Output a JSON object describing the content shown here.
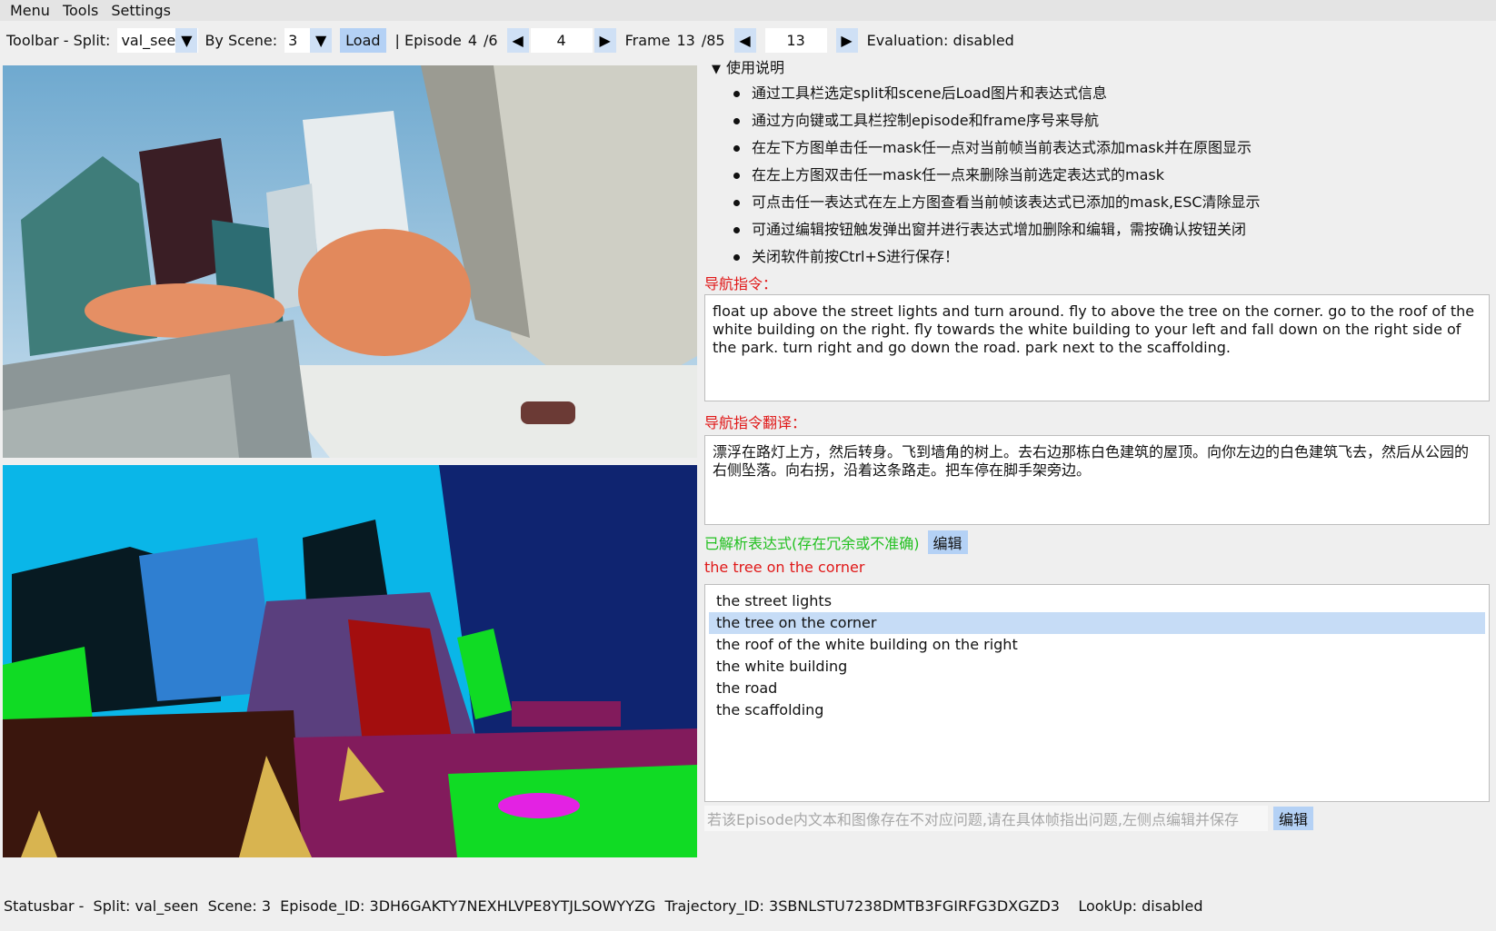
{
  "menubar": {
    "items": [
      "Menu",
      "Tools",
      "Settings"
    ]
  },
  "toolbar": {
    "split_label": "Toolbar - Split:",
    "split_value": "val_seen",
    "scene_label": "By Scene:",
    "scene_value": "3",
    "load_label": "Load",
    "episode_label": "| Episode",
    "episode_current": "4",
    "episode_total": "/6",
    "episode_input": "4",
    "frame_label": "Frame",
    "frame_current": "13",
    "frame_total": "/85",
    "frame_input": "13",
    "evaluation": "Evaluation: disabled"
  },
  "help": {
    "title": "使用说明",
    "items": [
      "通过工具栏选定split和scene后Load图片和表达式信息",
      "通过方向键或工具栏控制episode和frame序号来导航",
      "在左下方图单击任一mask任一点对当前帧当前表达式添加mask并在原图显示",
      "在左上方图双击任一mask任一点来删除当前选定表达式的mask",
      "可点击任一表达式在左上方图查看当前帧该表达式已添加的mask,ESC清除显示",
      "可通过编辑按钮触发弹出窗并进行表达式增加删除和编辑，需按确认按钮关闭",
      "关闭软件前按Ctrl+S进行保存！"
    ]
  },
  "instruction": {
    "label": "导航指令：",
    "text": "float up above the street lights and turn around. fly to above the tree on the corner. go to the roof of the white building on the right. fly towards the white building to your left and fall down on the right side of the park. turn right and go down the road. park next to the scaffolding."
  },
  "translation": {
    "label": "导航指令翻译：",
    "text": "漂浮在路灯上方，然后转身。飞到墙角的树上。去右边那栋白色建筑的屋顶。向你左边的白色建筑飞去，然后从公园的右侧坠落。向右拐，沿着这条路走。把车停在脚手架旁边。"
  },
  "expressions": {
    "label": "已解析表达式(存在冗余或不准确)",
    "edit_label": "编辑",
    "current": "the tree on the corner",
    "items": [
      "the street lights",
      "the tree on the corner",
      "the roof of the white building on the right",
      "the white building",
      "the road",
      "the scaffolding"
    ],
    "selected_index": 1
  },
  "issue": {
    "placeholder": "若该Episode内文本和图像存在不对应问题,请在具体帧指出问题,左侧点编辑并保存",
    "edit_label": "编辑"
  },
  "statusbar": {
    "text": "Statusbar -  Split: val_seen  Scene: 3  Episode_ID: 3DH6GAKTY7NEXHLVPE8YTJLSOWYYZG  Trajectory_ID: 3SBNLSTU7238DMTB3FGIRFG3DXGZD3    LookUp: disabled"
  },
  "colors": {
    "accent_button": "#b4d1f5",
    "red_label": "#e01818",
    "green_label": "#22c020",
    "selection": "#c6dcf6"
  }
}
